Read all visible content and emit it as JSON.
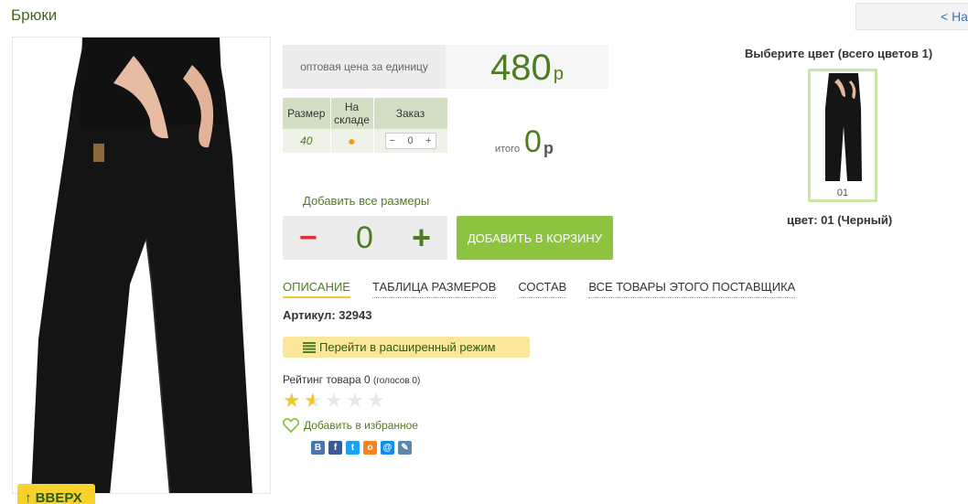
{
  "header": {
    "title": "Брюки",
    "back_label": "< На"
  },
  "product": {
    "price_label": "оптовая цена за единицу",
    "price_value": "480",
    "price_currency": "р",
    "total_label": "итого",
    "total_value": "0",
    "total_currency": "р"
  },
  "sizes_table": {
    "headers": [
      "Размер",
      "На складе",
      "Заказ"
    ],
    "rows": [
      {
        "size": "40",
        "stock": "●",
        "qty": "0"
      }
    ],
    "minus": "−",
    "plus": "+"
  },
  "add_all": {
    "label": "Добавить все размеры",
    "minus": "−",
    "value": "0",
    "plus": "+",
    "cart_button": "ДОБАВИТЬ В КОРЗИНУ"
  },
  "tabs": [
    "ОПИСАНИЕ",
    "ТАБЛИЦА РАЗМЕРОВ",
    "СОСТАВ",
    "ВСЕ ТОВАРЫ ЭТОГО ПОСТАВЩИКА"
  ],
  "article": {
    "label": "Артикул: 32943"
  },
  "extended_mode": "Перейти в расширенный режим",
  "rating": {
    "label": "Рейтинг товара 0",
    "votes": "(голосов 0)",
    "stars_filled": 1.5,
    "stars_total": 5
  },
  "favorite_label": "Добавить в избранное",
  "social": [
    {
      "icon": "vk-icon",
      "glyph": "В",
      "color": "#4a76a8"
    },
    {
      "icon": "facebook-icon",
      "glyph": "f",
      "color": "#3b5998"
    },
    {
      "icon": "twitter-icon",
      "glyph": "t",
      "color": "#1da1f2"
    },
    {
      "icon": "odnoklassniki-icon",
      "glyph": "о",
      "color": "#f48420"
    },
    {
      "icon": "mailru-icon",
      "glyph": "@",
      "color": "#168de2"
    },
    {
      "icon": "livejournal-icon",
      "glyph": "✎",
      "color": "#5a88b2"
    }
  ],
  "colors": {
    "title": "Выберите цвет (всего цветов 1)",
    "thumb_code": "01",
    "caption": "цвет: 01 (Черный)"
  },
  "up_button": "↑ ВВЕРХ",
  "accent_green": "#4c7e1f",
  "cart_green": "#8cc43f"
}
